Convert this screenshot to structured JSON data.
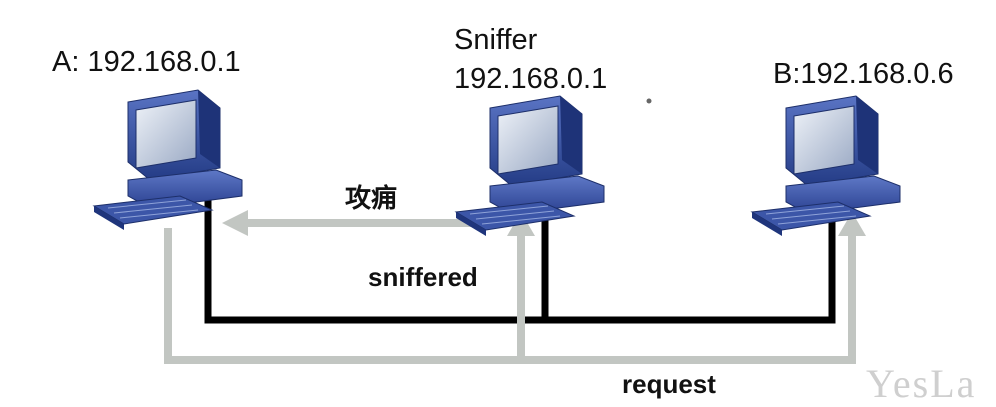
{
  "nodes": {
    "a": {
      "label": "A: 192.168.0.1"
    },
    "sniffer": {
      "title": "Sniffer",
      "ip": "192.168.0.1"
    },
    "b": {
      "label": "B:192.168.0.6"
    }
  },
  "edges": {
    "attack": {
      "label": "攻痈"
    },
    "sniffered": {
      "label": "sniffered"
    },
    "request": {
      "label": "request"
    }
  },
  "watermark": "YesLa",
  "colors": {
    "wire": "#000000",
    "flow": "#c2c6c2",
    "monitor_blue": "#2f4a9a",
    "screen": "#cfd8e8"
  }
}
